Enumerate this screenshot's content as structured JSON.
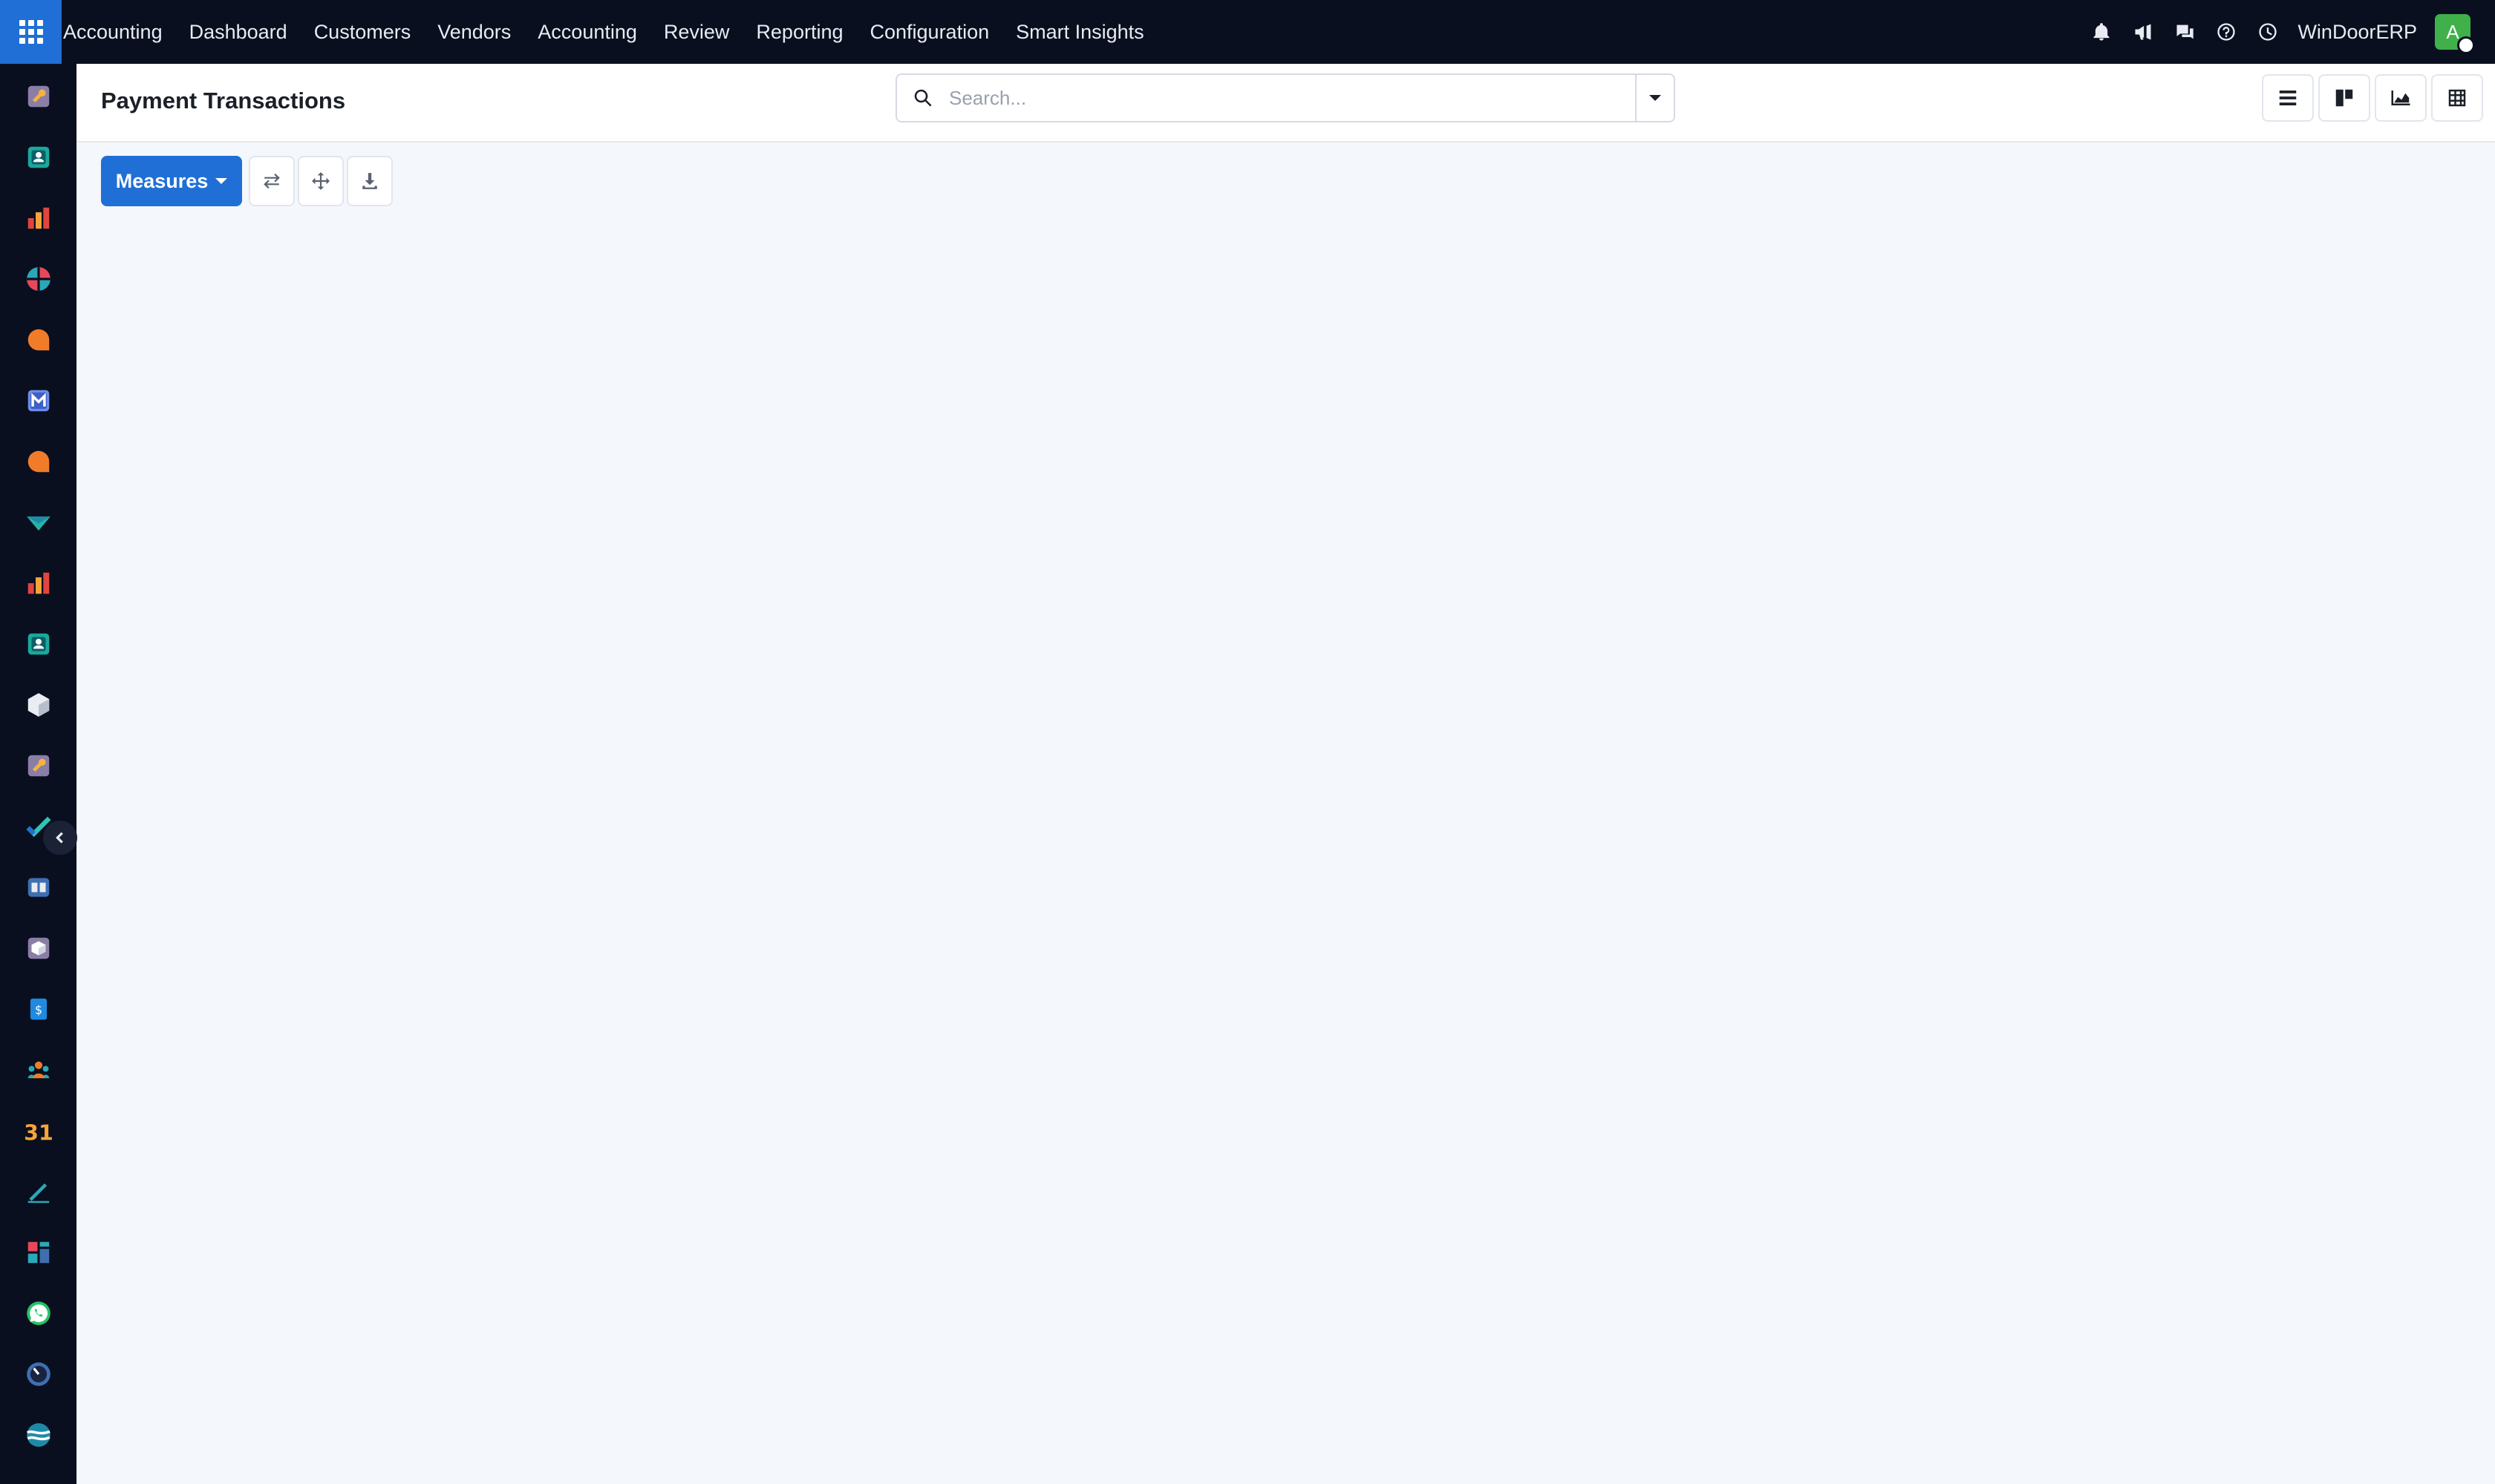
{
  "topbar": {
    "apps_icon": "grid-icon",
    "menu": [
      "Accounting",
      "Dashboard",
      "Customers",
      "Vendors",
      "Accounting",
      "Review",
      "Reporting",
      "Configuration",
      "Smart Insights"
    ],
    "company": "WinDoorERP",
    "avatar_initial": "A",
    "icons": [
      "bell-icon",
      "megaphone-icon",
      "chat-icon",
      "help-icon",
      "clock-icon"
    ]
  },
  "sidebar": {
    "apps": [
      "documents",
      "contacts",
      "spreadsheet",
      "knowledge",
      "discuss",
      "email-marketing",
      "livechat",
      "surveys",
      "dashboards",
      "employees",
      "inventory",
      "documents-2",
      "project",
      "knowledge-base",
      "products",
      "expenses",
      "team",
      "calendar",
      "sign",
      "apps",
      "whatsapp",
      "timer",
      "website"
    ]
  },
  "control_panel": {
    "title": "Payment Transactions",
    "search": {
      "placeholder": "Search..."
    },
    "views": [
      "list-view",
      "kanban-view",
      "graph-view",
      "pivot-view"
    ]
  },
  "actions": {
    "measures_label": "Measures",
    "tools": [
      "flip-axis-icon",
      "expand-all-icon",
      "download-icon"
    ]
  },
  "colors": {
    "navbar": "#0a0f1f",
    "accent": "#1f6fd6",
    "background": "#f4f7fb",
    "avatar": "#3fb04a"
  }
}
